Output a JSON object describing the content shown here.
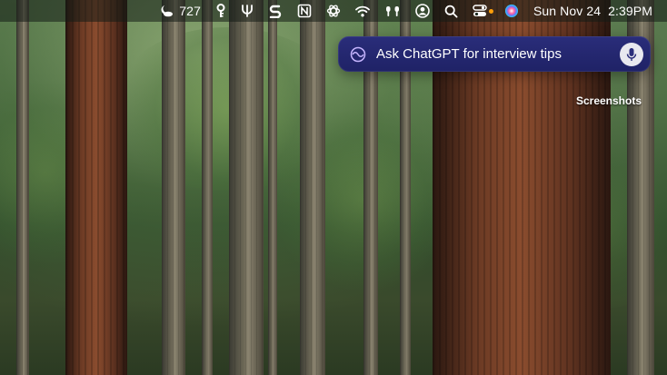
{
  "menubar": {
    "weather": {
      "icon": "moon-cloud-icon",
      "value": "727"
    },
    "icons": [
      "key-icon",
      "fork-icon",
      "script-icon",
      "notion-icon",
      "openai-icon",
      "wifi-icon",
      "airpods-icon",
      "user-account-icon",
      "search-icon",
      "control-center-icon",
      "siri-icon"
    ],
    "date": "Sun Nov 24",
    "time": "2:39PM"
  },
  "chatbar": {
    "placeholder": "Ask ChatGPT for interview tips",
    "accent": "#2a2d7a"
  },
  "desktop": {
    "folder_label": "Screenshots"
  }
}
